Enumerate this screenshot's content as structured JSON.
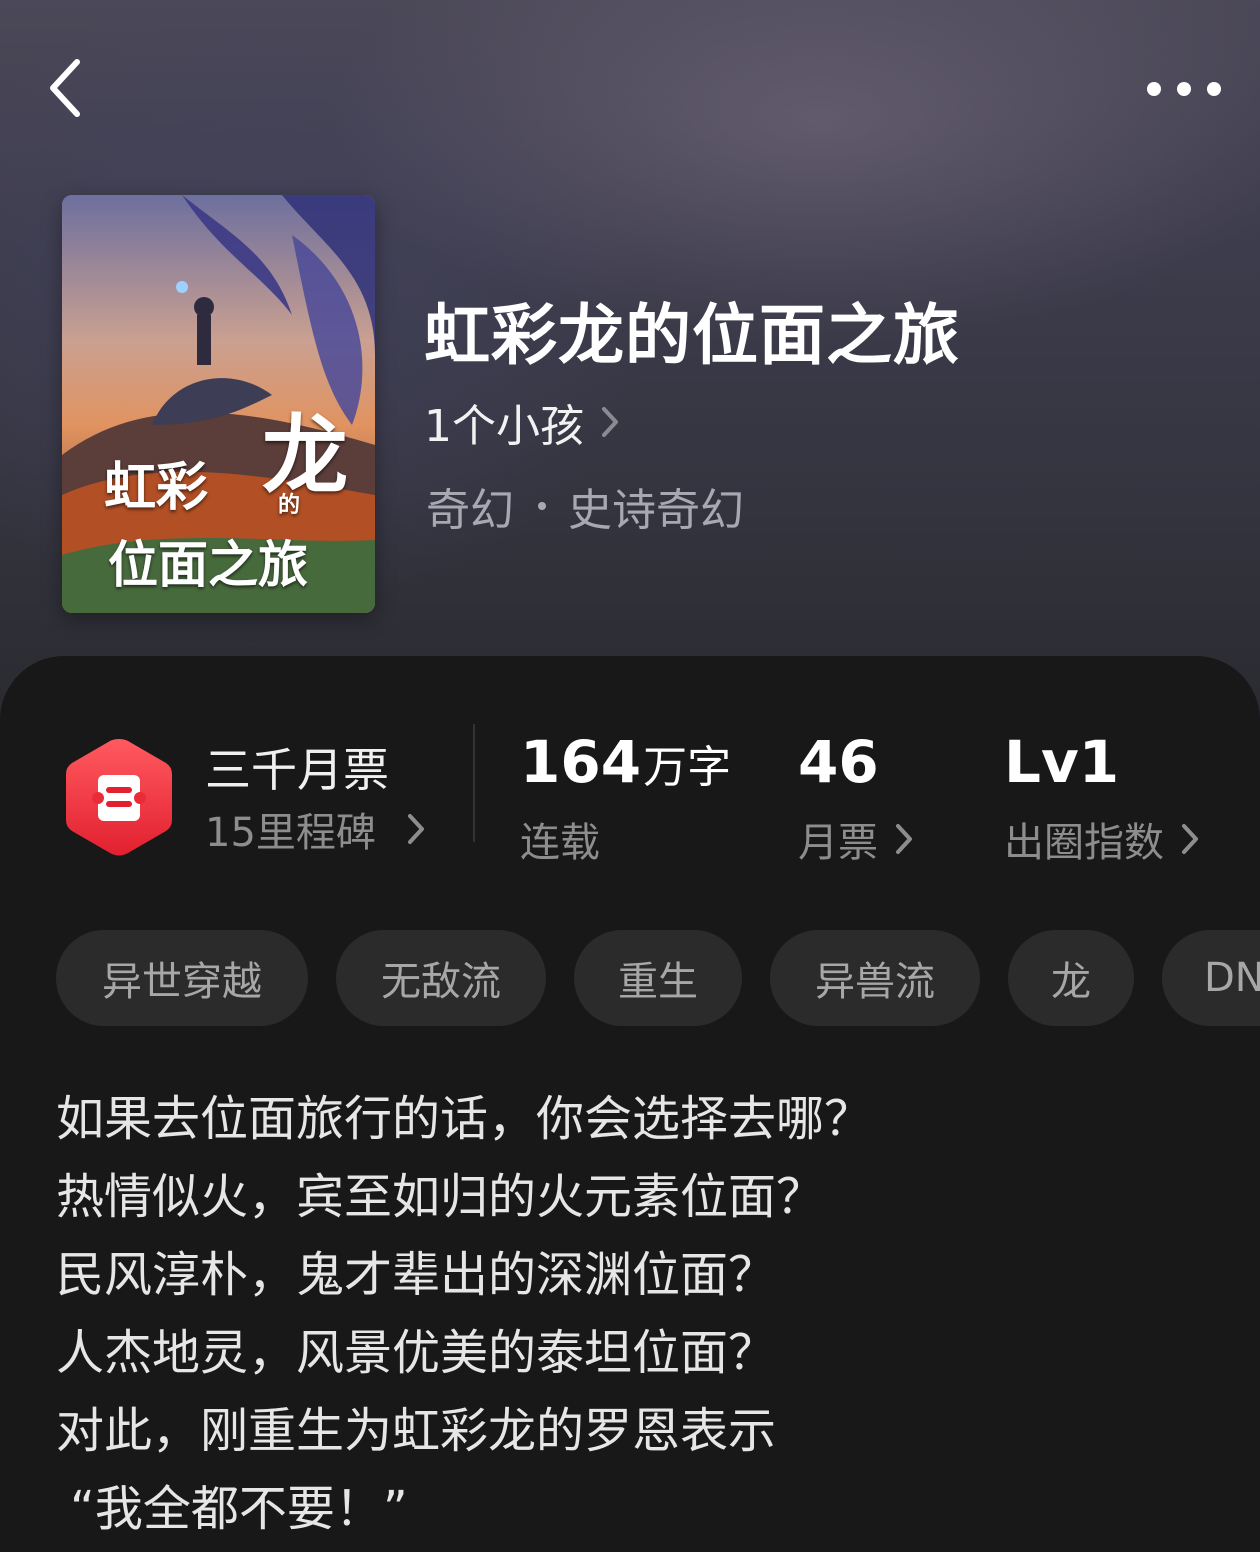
{
  "header": {
    "back_icon": "chevron-left-icon",
    "more_icon": "more-horizontal-icon"
  },
  "book": {
    "cover_title_lines": [
      "虹彩",
      "龙",
      "的",
      "位面之旅"
    ],
    "title": "虹彩龙的位面之旅",
    "author": "1个小孩",
    "genre": "奇幻",
    "subgenre": "史诗奇幻"
  },
  "stats": {
    "milestone_title": "三千月票",
    "milestone_sub": "15里程碑",
    "word_count_number": "164",
    "word_count_unit": "万字",
    "status": "连载",
    "monthly_tickets": "46",
    "monthly_tickets_label": "月票",
    "circle_index": "Lv1",
    "circle_index_label": "出圈指数"
  },
  "tags": [
    "异世穿越",
    "无敌流",
    "重生",
    "异兽流",
    "龙",
    "DND"
  ],
  "synopsis": [
    "如果去位面旅行的话，你会选择去哪？",
    "热情似火，宾至如归的火元素位面？",
    "民风淳朴，鬼才辈出的深渊位面？",
    "人杰地灵，风景优美的泰坦位面？",
    "对此，刚重生为虹彩龙的罗恩表示",
    "“我全都不要！”"
  ],
  "colors": {
    "badge_red": "#f0343f",
    "background": "#181818",
    "tag_bg": "#2b2b2b"
  }
}
